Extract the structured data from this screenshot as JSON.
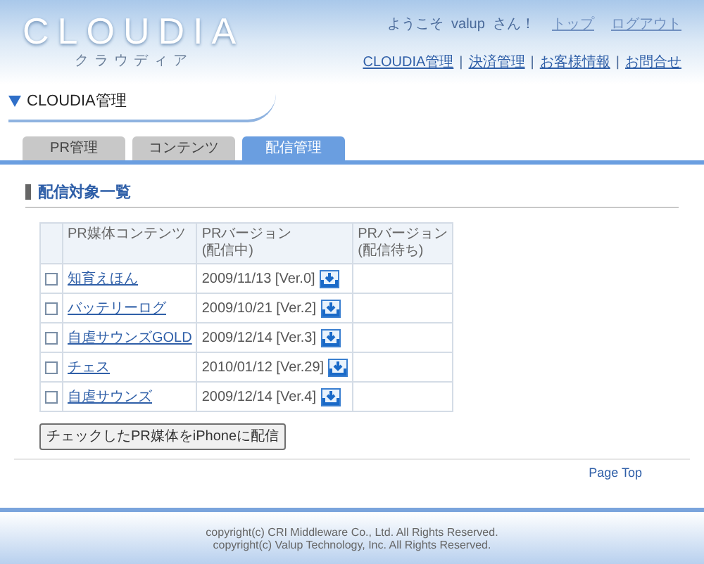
{
  "header": {
    "logo": "CLOUDIA",
    "logo_sub": "クラウディア",
    "welcome": "ようこそ  valup  さん！",
    "top_links": [
      "トップ",
      "ログアウト"
    ],
    "nav_links": [
      "CLOUDIA管理",
      "決済管理",
      "お客様情報",
      "お問合せ"
    ],
    "separator": "|"
  },
  "section_title": "CLOUDIA管理",
  "tabs": [
    {
      "label": "PR管理",
      "selected": false
    },
    {
      "label": "コンテンツ",
      "selected": false
    },
    {
      "label": "配信管理",
      "selected": true
    }
  ],
  "heading": "配信対象一覧",
  "table": {
    "columns": [
      "PR媒体コンテンツ",
      "PRバージョン\n(配信中)",
      "PRバージョン\n(配信待ち)"
    ],
    "rows": [
      {
        "checked": false,
        "name": "知育えほん",
        "version": "2009/11/13 [Ver.0]"
      },
      {
        "checked": false,
        "name": "バッテリーログ",
        "version": "2009/10/21 [Ver.2]"
      },
      {
        "checked": false,
        "name": "自虐サウンズGOLD",
        "version": "2009/12/14 [Ver.3]"
      },
      {
        "checked": false,
        "name": "チェス",
        "version": "2010/01/12 [Ver.29]"
      },
      {
        "checked": false,
        "name": "自虐サウンズ",
        "version": "2009/12/14 [Ver.4]"
      }
    ]
  },
  "submit_button": "チェックしたPR媒体をiPhoneに配信",
  "page_top": "Page Top",
  "footer": [
    "copyright(c) CRI Middleware Co., Ltd. All Rights Reserved.",
    "copyright(c) Valup Technology, Inc. All Rights Reserved."
  ]
}
